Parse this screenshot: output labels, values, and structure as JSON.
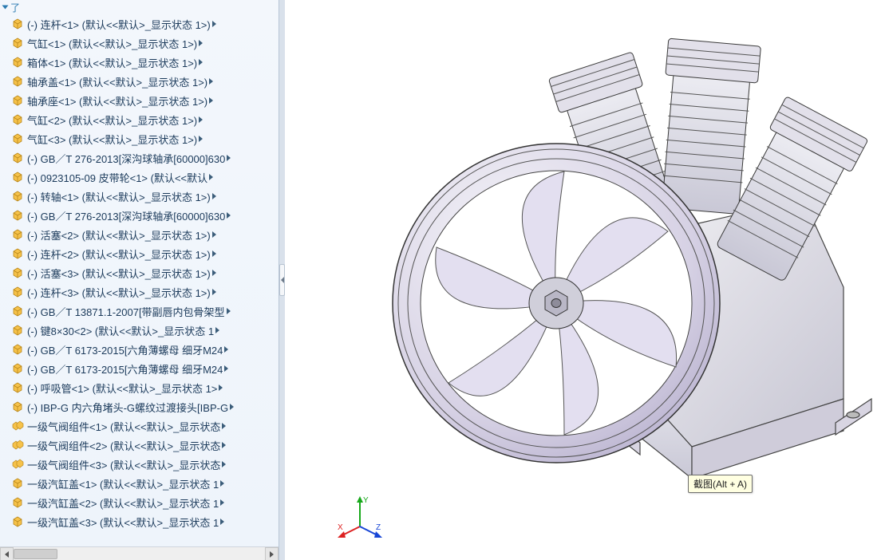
{
  "tree": {
    "header_label": "了",
    "items": [
      {
        "label": "(-) 连杆<1> (默认<<默认>_显示状态 1>)",
        "icon": "part"
      },
      {
        "label": "气缸<1> (默认<<默认>_显示状态 1>)",
        "icon": "part"
      },
      {
        "label": "箱体<1> (默认<<默认>_显示状态 1>)",
        "icon": "part"
      },
      {
        "label": "轴承盖<1> (默认<<默认>_显示状态 1>)",
        "icon": "part"
      },
      {
        "label": "轴承座<1> (默认<<默认>_显示状态 1>)",
        "icon": "part"
      },
      {
        "label": "气缸<2> (默认<<默认>_显示状态 1>)",
        "icon": "part"
      },
      {
        "label": "气缸<3> (默认<<默认>_显示状态 1>)",
        "icon": "part"
      },
      {
        "label": "(-) GB／T 276-2013[深沟球轴承[60000]630",
        "icon": "part"
      },
      {
        "label": "(-) 0923105-09 皮带轮<1> (默认<<默认",
        "icon": "part"
      },
      {
        "label": "(-) 转轴<1> (默认<<默认>_显示状态 1>)",
        "icon": "part"
      },
      {
        "label": "(-) GB／T 276-2013[深沟球轴承[60000]630",
        "icon": "part"
      },
      {
        "label": "(-) 活塞<2> (默认<<默认>_显示状态 1>)",
        "icon": "part"
      },
      {
        "label": "(-) 连杆<2> (默认<<默认>_显示状态 1>)",
        "icon": "part"
      },
      {
        "label": "(-) 活塞<3> (默认<<默认>_显示状态 1>)",
        "icon": "part"
      },
      {
        "label": "(-) 连杆<3> (默认<<默认>_显示状态 1>)",
        "icon": "part"
      },
      {
        "label": "(-) GB／T 13871.1-2007[带副唇内包骨架型",
        "icon": "part"
      },
      {
        "label": "(-) 键8×30<2> (默认<<默认>_显示状态 1",
        "icon": "part"
      },
      {
        "label": "(-) GB／T 6173-2015[六角薄螺母 细牙M24",
        "icon": "part"
      },
      {
        "label": "(-) GB／T 6173-2015[六角薄螺母 细牙M24",
        "icon": "part"
      },
      {
        "label": "(-) 呼吸管<1> (默认<<默认>_显示状态 1>",
        "icon": "part"
      },
      {
        "label": "(-) IBP-G 内六角堵头-G螺纹过渡接头[IBP-G",
        "icon": "part"
      },
      {
        "label": "一级气阀组件<1> (默认<<默认>_显示状态",
        "icon": "asm"
      },
      {
        "label": "一级气阀组件<2> (默认<<默认>_显示状态",
        "icon": "asm"
      },
      {
        "label": "一级气阀组件<3> (默认<<默认>_显示状态",
        "icon": "asm"
      },
      {
        "label": "一级汽缸盖<1> (默认<<默认>_显示状态 1",
        "icon": "part"
      },
      {
        "label": "一级汽缸盖<2> (默认<<默认>_显示状态 1",
        "icon": "part"
      },
      {
        "label": "一级汽缸盖<3> (默认<<默认>_显示状态 1",
        "icon": "part"
      }
    ]
  },
  "viewport": {
    "tooltip_text": "截图(Alt + A)",
    "triad": {
      "x": "X",
      "y": "Y",
      "z": "Z"
    }
  }
}
